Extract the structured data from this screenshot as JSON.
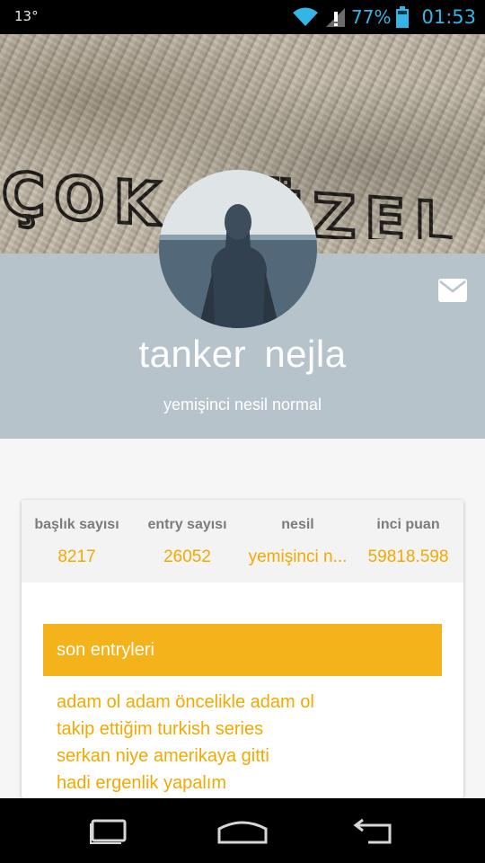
{
  "status_bar": {
    "temperature": "13°",
    "battery": "77%",
    "time": "01:53"
  },
  "profile": {
    "name": "tanker  nejla",
    "generation": "yemişinci nesil normal",
    "cover_graffiti_text": "ÇOK GÜZEL"
  },
  "stats": [
    {
      "label": "başlık sayısı",
      "value": "8217"
    },
    {
      "label": "entry sayısı",
      "value": "26052"
    },
    {
      "label": "nesil",
      "value": "yemişinci n..."
    },
    {
      "label": "inci puan",
      "value": "59818.598"
    }
  ],
  "entries": {
    "header": "son entryleri",
    "items": [
      "adam ol adam öncelikle adam ol",
      "takip ettiğim turkish series",
      "serkan niye amerikaya gitti",
      "hadi ergenlik yapalım"
    ]
  },
  "colors": {
    "accent": "#f4b21b",
    "accent_text": "#f2a900",
    "profile_band": "#b6c3cb",
    "status_blue": "#33b5e5"
  },
  "icons": {
    "mail": "mail-icon",
    "wifi": "wifi-icon",
    "signal": "signal-icon",
    "battery": "battery-icon",
    "recent_apps": "recent-apps-icon",
    "home": "home-icon",
    "back": "back-icon"
  }
}
